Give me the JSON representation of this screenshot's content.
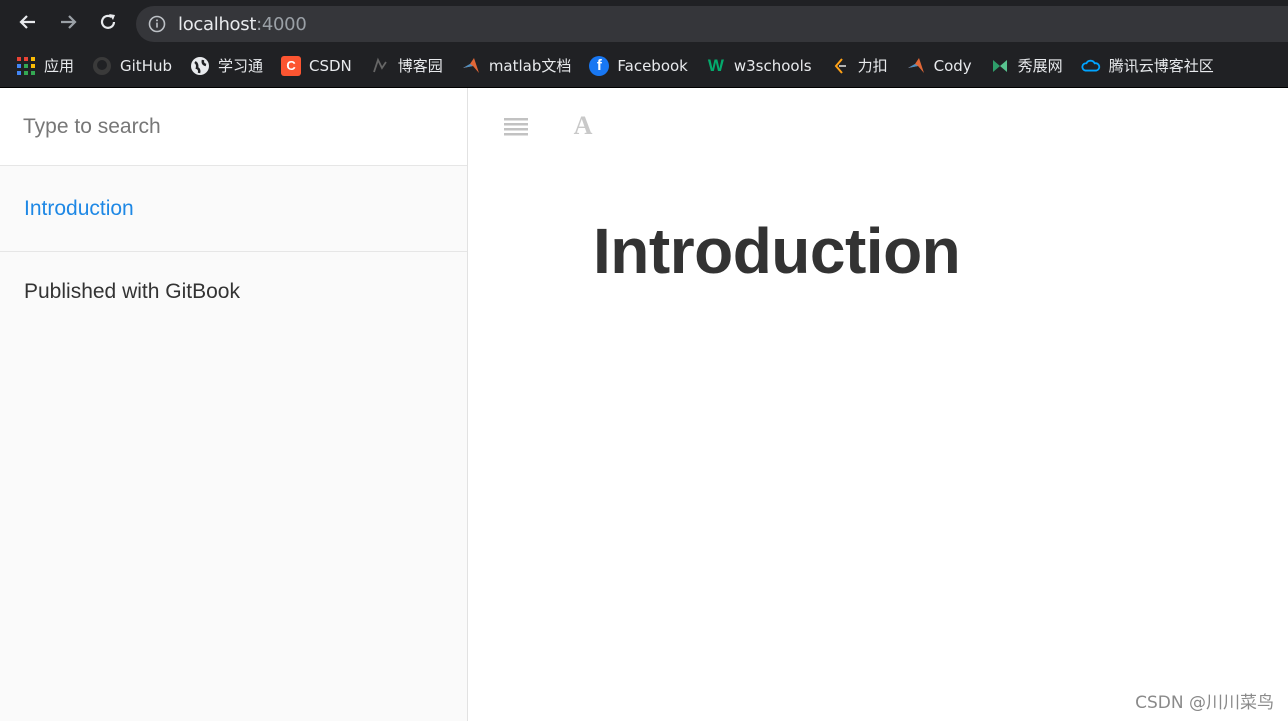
{
  "browser": {
    "url_host": "localhost",
    "url_port": ":4000",
    "bookmarks": [
      {
        "label": "应用",
        "icon": "apps-grid-icon",
        "color": "#ea4335"
      },
      {
        "label": "GitHub",
        "icon": "github-icon",
        "color": "#444444"
      },
      {
        "label": "学习通",
        "icon": "globe-icon",
        "color": "#ffffff"
      },
      {
        "label": "CSDN",
        "icon": "csdn-icon",
        "color": "#fc5531"
      },
      {
        "label": "博客园",
        "icon": "cnblogs-icon",
        "color": "#555555"
      },
      {
        "label": "matlab文档",
        "icon": "matlab-icon",
        "color": "#e16737"
      },
      {
        "label": "Facebook",
        "icon": "facebook-icon",
        "color": "#1877f2"
      },
      {
        "label": "w3schools",
        "icon": "w3schools-icon",
        "color": "#04aa6d"
      },
      {
        "label": "力扣",
        "icon": "leetcode-icon",
        "color": "#ffa116"
      },
      {
        "label": "Cody",
        "icon": "matlab-icon",
        "color": "#e16737"
      },
      {
        "label": "秀展网",
        "icon": "xiuzhan-icon",
        "color": "#2e9e6a"
      },
      {
        "label": "腾讯云博客社区",
        "icon": "tencent-cloud-icon",
        "color": "#00a4ff"
      }
    ]
  },
  "sidebar": {
    "search_placeholder": "Type to search",
    "items": [
      {
        "label": "Introduction"
      }
    ],
    "published": "Published with GitBook"
  },
  "main": {
    "title": "Introduction"
  },
  "watermark": "CSDN @川川菜鸟"
}
